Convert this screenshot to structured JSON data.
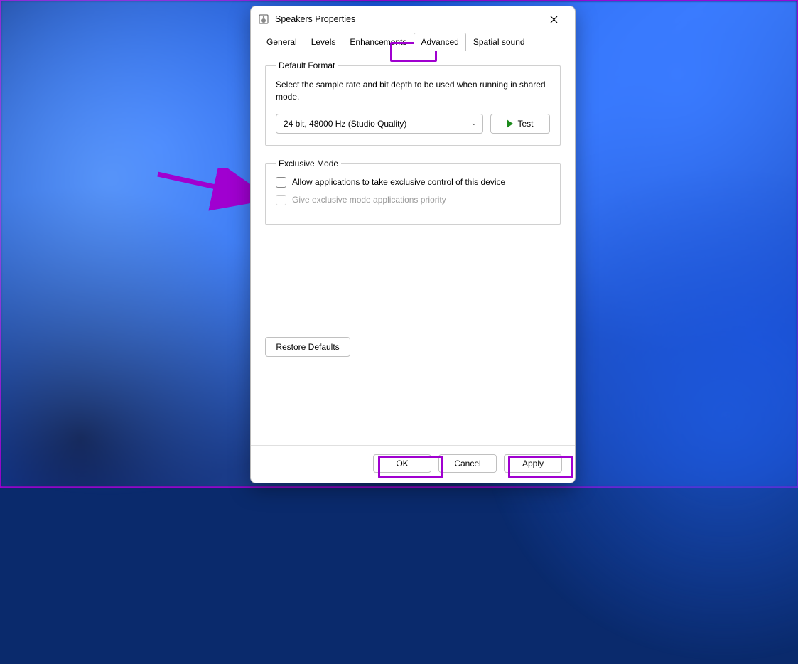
{
  "window": {
    "title": "Speakers Properties"
  },
  "tabs": {
    "general": "General",
    "levels": "Levels",
    "enhancements": "Enhancements",
    "advanced": "Advanced",
    "spatial": "Spatial sound"
  },
  "default_format": {
    "legend": "Default Format",
    "description": "Select the sample rate and bit depth to be used when running in shared mode.",
    "selected": "24 bit, 48000 Hz (Studio Quality)",
    "test_label": "Test"
  },
  "exclusive_mode": {
    "legend": "Exclusive Mode",
    "allow_label": "Allow applications to take exclusive control of this device",
    "priority_label": "Give exclusive mode applications priority"
  },
  "restore_label": "Restore Defaults",
  "buttons": {
    "ok": "OK",
    "cancel": "Cancel",
    "apply": "Apply"
  }
}
